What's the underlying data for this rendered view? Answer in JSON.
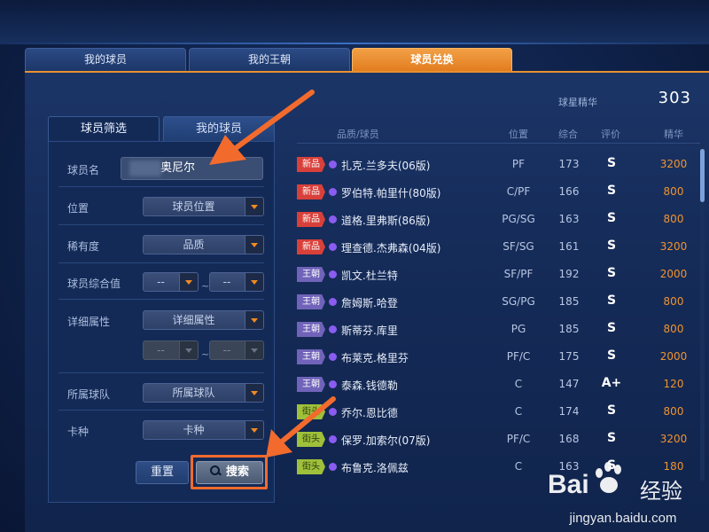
{
  "main_tabs": [
    {
      "label": "我的球员"
    },
    {
      "label": "我的王朝"
    },
    {
      "label": "球员兑换"
    }
  ],
  "essence": {
    "label": "球星精华",
    "value": "303"
  },
  "filter": {
    "tabs": [
      {
        "label": "球员筛选"
      },
      {
        "label": "我的球员"
      }
    ],
    "name_label": "球员名",
    "name_value": "奥尼尔",
    "position_label": "位置",
    "position_select": "球员位置",
    "rarity_label": "稀有度",
    "rarity_select": "品质",
    "overall_label": "球员综合值",
    "overall_min": "--",
    "overall_max": "--",
    "range_sep": "~",
    "detail_label": "详细属性",
    "detail_select": "详细属性",
    "detail_min": "--",
    "detail_max": "--",
    "team_label": "所属球队",
    "team_select": "所属球队",
    "card_label": "卡种",
    "card_select": "卡种",
    "reset_button": "重置",
    "search_button": "搜索"
  },
  "list": {
    "headers": {
      "player": "品质/球员",
      "position": "位置",
      "overall": "综合",
      "grade": "评价",
      "essence": "精华"
    },
    "rows": [
      {
        "tag": "新品",
        "tag_type": "new",
        "name": "扎克.兰多夫(06版)",
        "position": "PF",
        "overall": "173",
        "grade": "S",
        "essence": "3200"
      },
      {
        "tag": "新品",
        "tag_type": "new",
        "name": "罗伯特.帕里什(80版)",
        "position": "C/PF",
        "overall": "166",
        "grade": "S",
        "essence": "800"
      },
      {
        "tag": "新品",
        "tag_type": "new",
        "name": "道格.里弗斯(86版)",
        "position": "PG/SG",
        "overall": "163",
        "grade": "S",
        "essence": "800"
      },
      {
        "tag": "新品",
        "tag_type": "new",
        "name": "理查德.杰弗森(04版)",
        "position": "SF/SG",
        "overall": "161",
        "grade": "S",
        "essence": "3200"
      },
      {
        "tag": "王朝",
        "tag_type": "dynasty",
        "name": "凯文.杜兰特",
        "position": "SF/PF",
        "overall": "192",
        "grade": "S",
        "essence": "2000"
      },
      {
        "tag": "王朝",
        "tag_type": "dynasty",
        "name": "詹姆斯.哈登",
        "position": "SG/PG",
        "overall": "185",
        "grade": "S",
        "essence": "800"
      },
      {
        "tag": "王朝",
        "tag_type": "dynasty",
        "name": "斯蒂芬.库里",
        "position": "PG",
        "overall": "185",
        "grade": "S",
        "essence": "800"
      },
      {
        "tag": "王朝",
        "tag_type": "dynasty",
        "name": "布莱克.格里芬",
        "position": "PF/C",
        "overall": "175",
        "grade": "S",
        "essence": "2000"
      },
      {
        "tag": "王朝",
        "tag_type": "dynasty",
        "name": "泰森.钱德勒",
        "position": "C",
        "overall": "147",
        "grade": "A+",
        "essence": "120"
      },
      {
        "tag": "街头",
        "tag_type": "street",
        "name": "乔尔.恩比德",
        "position": "C",
        "overall": "174",
        "grade": "S",
        "essence": "800"
      },
      {
        "tag": "街头",
        "tag_type": "street",
        "name": "保罗.加索尔(07版)",
        "position": "PF/C",
        "overall": "168",
        "grade": "S",
        "essence": "3200"
      },
      {
        "tag": "街头",
        "tag_type": "street",
        "name": "布鲁克.洛佩兹",
        "position": "C",
        "overall": "163",
        "grade": "S",
        "essence": "180"
      }
    ]
  },
  "watermark": {
    "logo": "Bai",
    "logo_suffix": "经验",
    "url": "jingyan.baidu.com"
  },
  "colors": {
    "accent": "#e8912f",
    "essence_text": "#f0932e",
    "annotation": "#f26b2d",
    "tag_new": "#d9403a",
    "tag_dynasty": "#7063b9",
    "tag_street": "#9fc03a"
  }
}
